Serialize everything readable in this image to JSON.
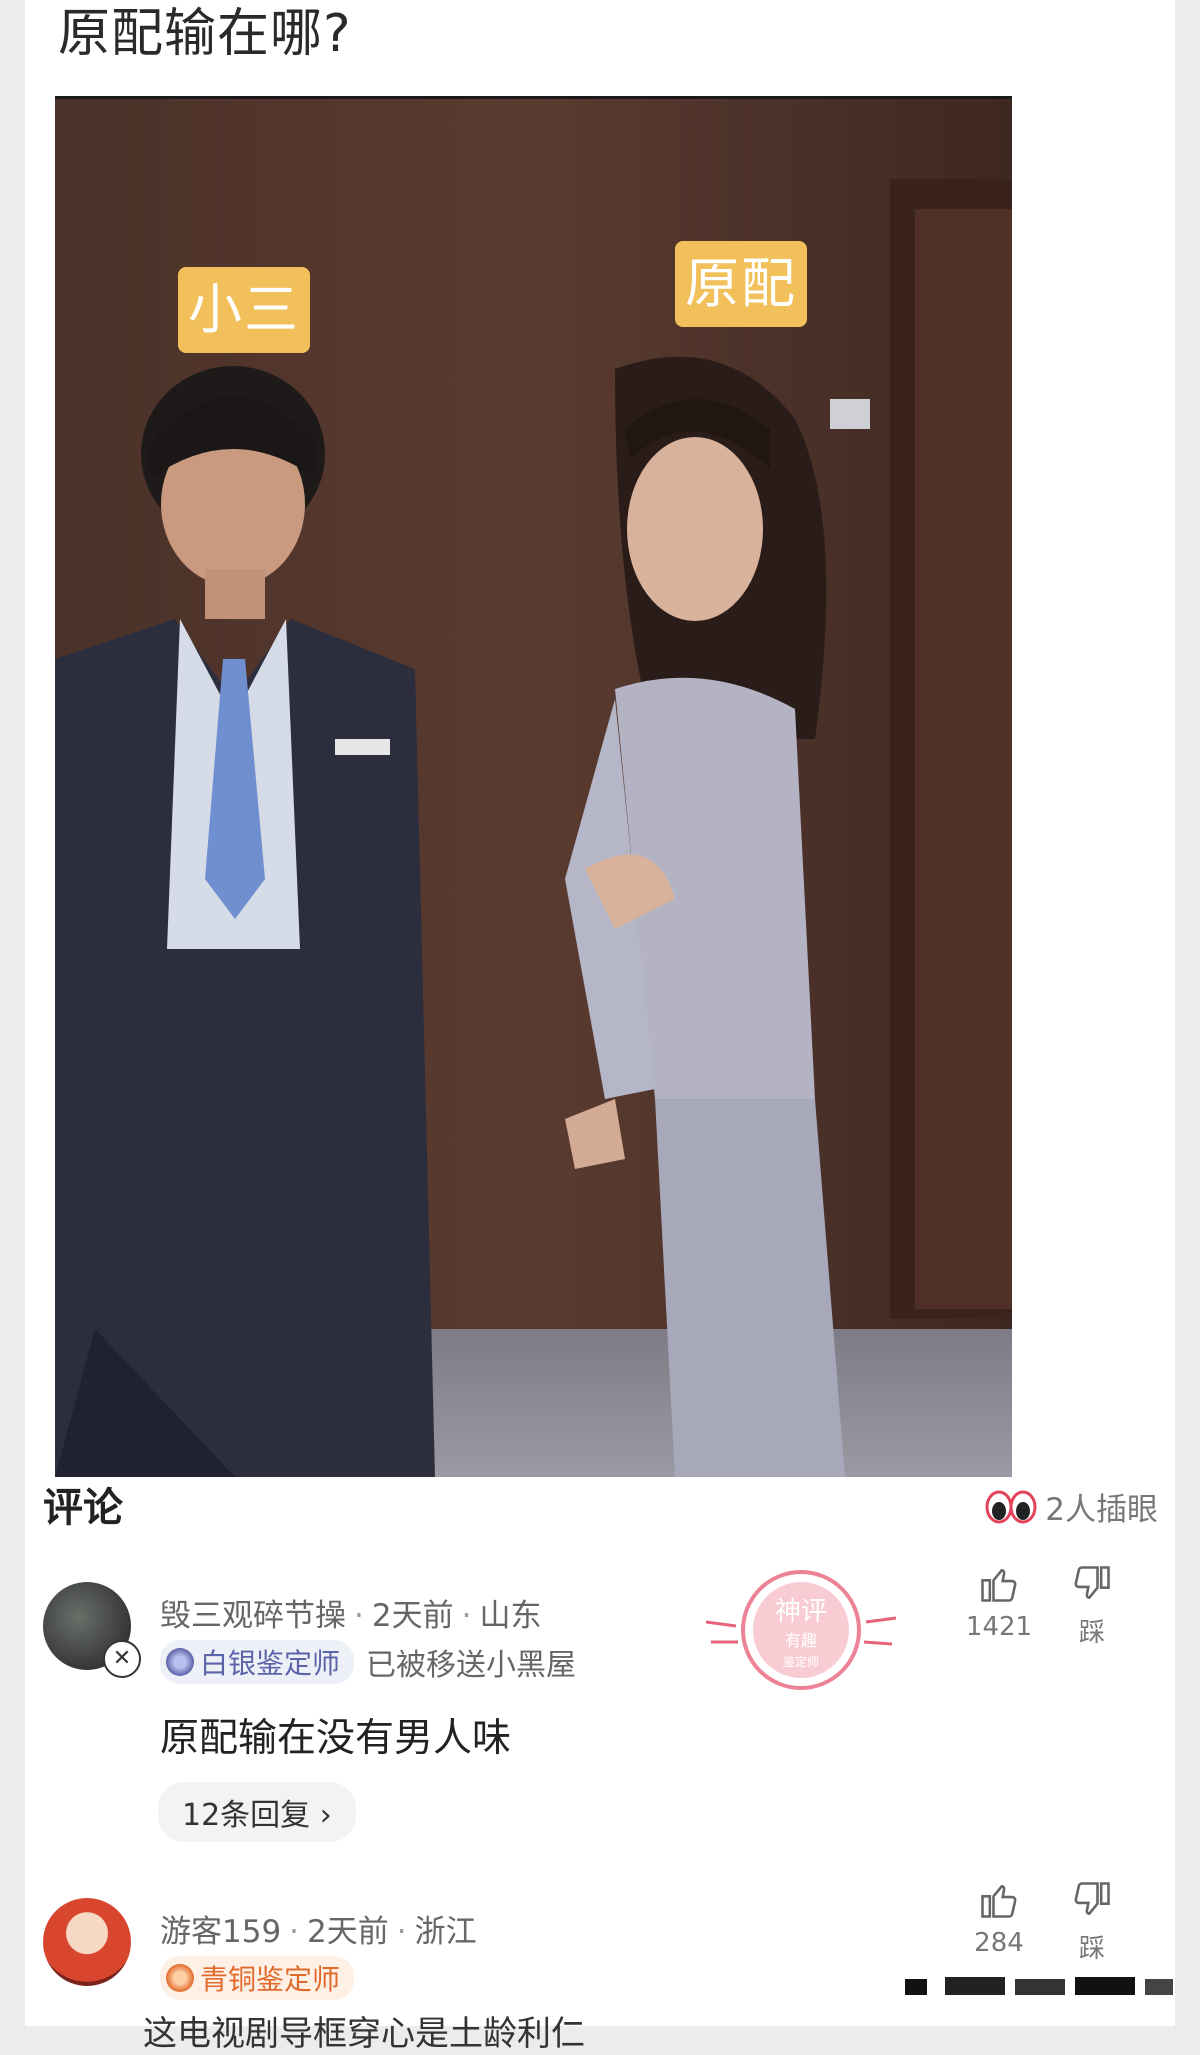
{
  "post": {
    "title": "原配输在哪?"
  },
  "photo": {
    "left_tag": "小三",
    "right_tag": "原配"
  },
  "comments_section": {
    "heading": "评论",
    "watchers_text": "2人插眼"
  },
  "comments": [
    {
      "username": "毁三观碎节操",
      "time": "2天前",
      "location": "山东",
      "rank": "白银鉴定师",
      "status": "已被移送小黑屋",
      "text": "原配输在没有男人味",
      "replies": "12条回复",
      "likes": "1421",
      "dislike_label": "踩",
      "stamp_text_top": "神评",
      "stamp_text_mid": "有趣",
      "stamp_text_bottom": "鉴定师"
    },
    {
      "username": "游客159",
      "time": "2天前",
      "location": "浙江",
      "rank": "青铜鉴定师",
      "likes": "284",
      "dislike_label": "踩",
      "text_partial": "这电视剧导框穿心是土龄利仁"
    }
  ],
  "colors": {
    "tag_yellow": "#f2c05a",
    "silver_badge": "#5b64a8",
    "bronze_badge": "#e06a2c",
    "stamp_red": "#e7637a"
  },
  "icons": [
    "eyes-icon",
    "thumbs-up-icon",
    "thumbs-down-icon",
    "chevron-right-icon",
    "rank-icon",
    "mute-icon"
  ]
}
